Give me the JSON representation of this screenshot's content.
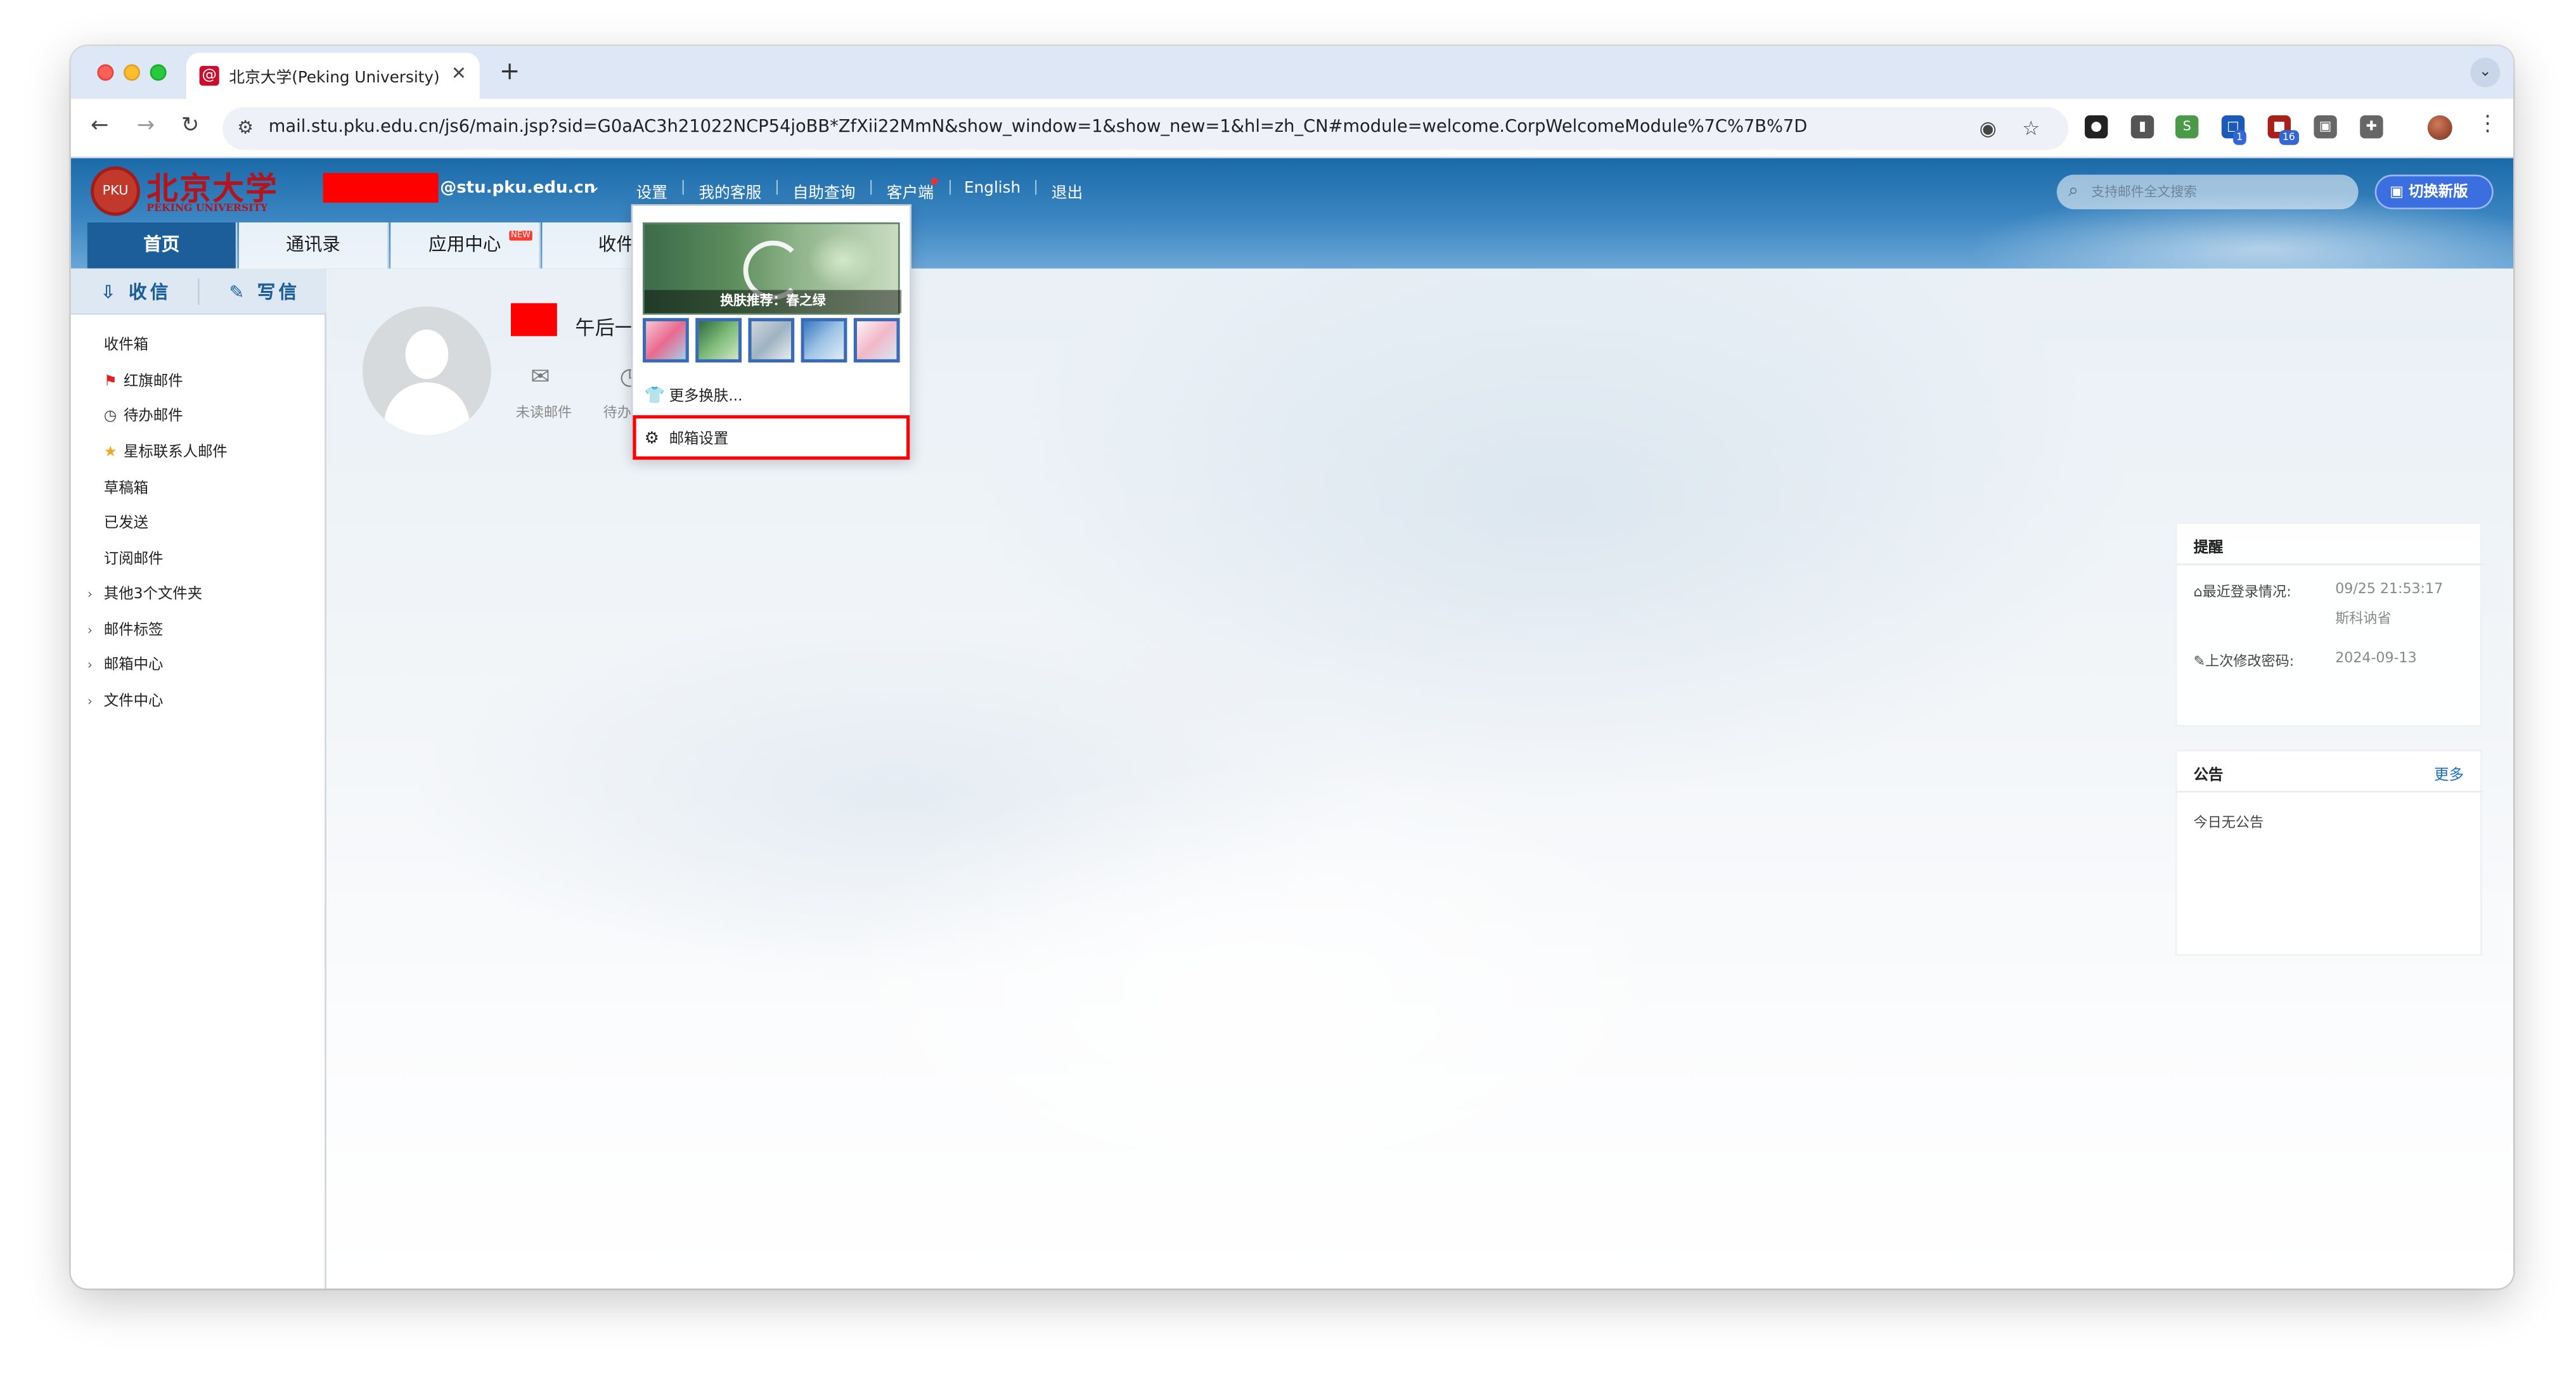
{
  "browser": {
    "tab_title": "北京大学(Peking University)",
    "tab_favicon": "@",
    "url": "mail.stu.pku.edu.cn/js6/main.jsp?sid=G0aAC3h21022NCP54joBB*ZfXii22MmN&show_window=1&show_new=1&hl=zh_CN#module=welcome.CorpWelcomeModule%7C%7B%7D",
    "extension_badges": [
      "1",
      "16"
    ]
  },
  "header": {
    "logo_text": "北京大学",
    "logo_sub": "PEKING UNIVERSITY",
    "email_domain": "@stu.pku.edu.cn",
    "topnav": [
      "设置",
      "我的客服",
      "自助查询",
      "客户端",
      "English",
      "退出"
    ],
    "search_placeholder": "支持邮件全文搜索",
    "switch_label": "切换新版",
    "tabs": [
      "首页",
      "通讯录",
      "应用中心",
      "收件"
    ],
    "new_badge": "NEW"
  },
  "sidebar": {
    "receive": "收信",
    "compose": "写信",
    "folders": [
      "收件箱",
      "红旗邮件",
      "待办邮件",
      "星标联系人邮件",
      "草稿箱",
      "已发送",
      "订阅邮件"
    ],
    "expandables": [
      "其他3个文件夹",
      "邮件标签",
      "邮箱中心",
      "文件中心"
    ]
  },
  "welcome": {
    "greeting": "午后一",
    "stats": [
      "未读邮件",
      "待办"
    ]
  },
  "dropdown": {
    "skin_caption": "换肤推荐：春之绿",
    "more_skins": "更多换肤...",
    "mail_settings": "邮箱设置"
  },
  "reminder": {
    "title": "提醒",
    "last_login_label": "最近登录情况:",
    "last_login_time": "09/25 21:53:17",
    "last_login_place": "斯科讷省",
    "pwd_label": "上次修改密码:",
    "pwd_date": "2024-09-13"
  },
  "notice": {
    "title": "公告",
    "more": "更多",
    "empty": "今日无公告"
  },
  "colors": {
    "header_blue": "#1b6aa8",
    "active_tab": "#1b5e9a",
    "highlight": "#ff0000",
    "switch_btn": "#3b6fe0"
  }
}
